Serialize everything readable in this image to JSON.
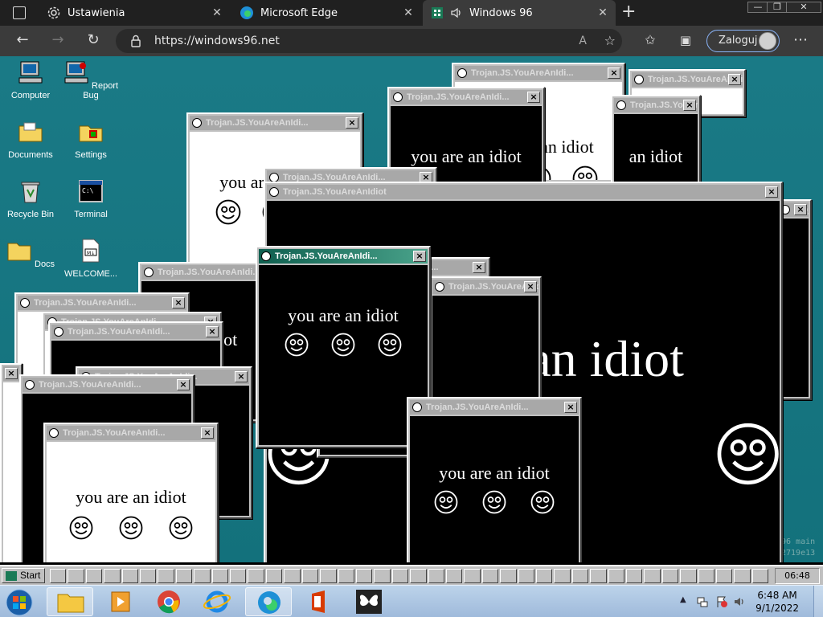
{
  "browser": {
    "tabs": [
      {
        "label": "Ustawienia",
        "icon": "gear-icon"
      },
      {
        "label": "Microsoft Edge",
        "icon": "edge-icon"
      },
      {
        "label": "Windows 96",
        "icon": "win96-icon"
      }
    ],
    "url": "https://windows96.net",
    "login_label": "Zaloguj"
  },
  "desktop": {
    "icons": [
      {
        "label": "Computer"
      },
      {
        "label": "Report Bug"
      },
      {
        "label": "Documents"
      },
      {
        "label": "Settings"
      },
      {
        "label": "Recycle Bin"
      },
      {
        "label": "Terminal"
      },
      {
        "label": "Docs"
      },
      {
        "label": "WELCOME..."
      }
    ]
  },
  "popup": {
    "title_long": "Trojan.JS.YouAreAnIdiot",
    "title_short": "Trojan.JS.YouAreAnIdi...",
    "message": "you are an idiot",
    "message_partial": "an idiot",
    "close": "×"
  },
  "bg_text": {
    "line1": "96 main",
    "line2": "2719e13"
  },
  "taskbar96": {
    "start": "Start",
    "clock": "06:48"
  },
  "taskbar7": {
    "time": "6:48 AM",
    "date": "9/1/2022"
  }
}
